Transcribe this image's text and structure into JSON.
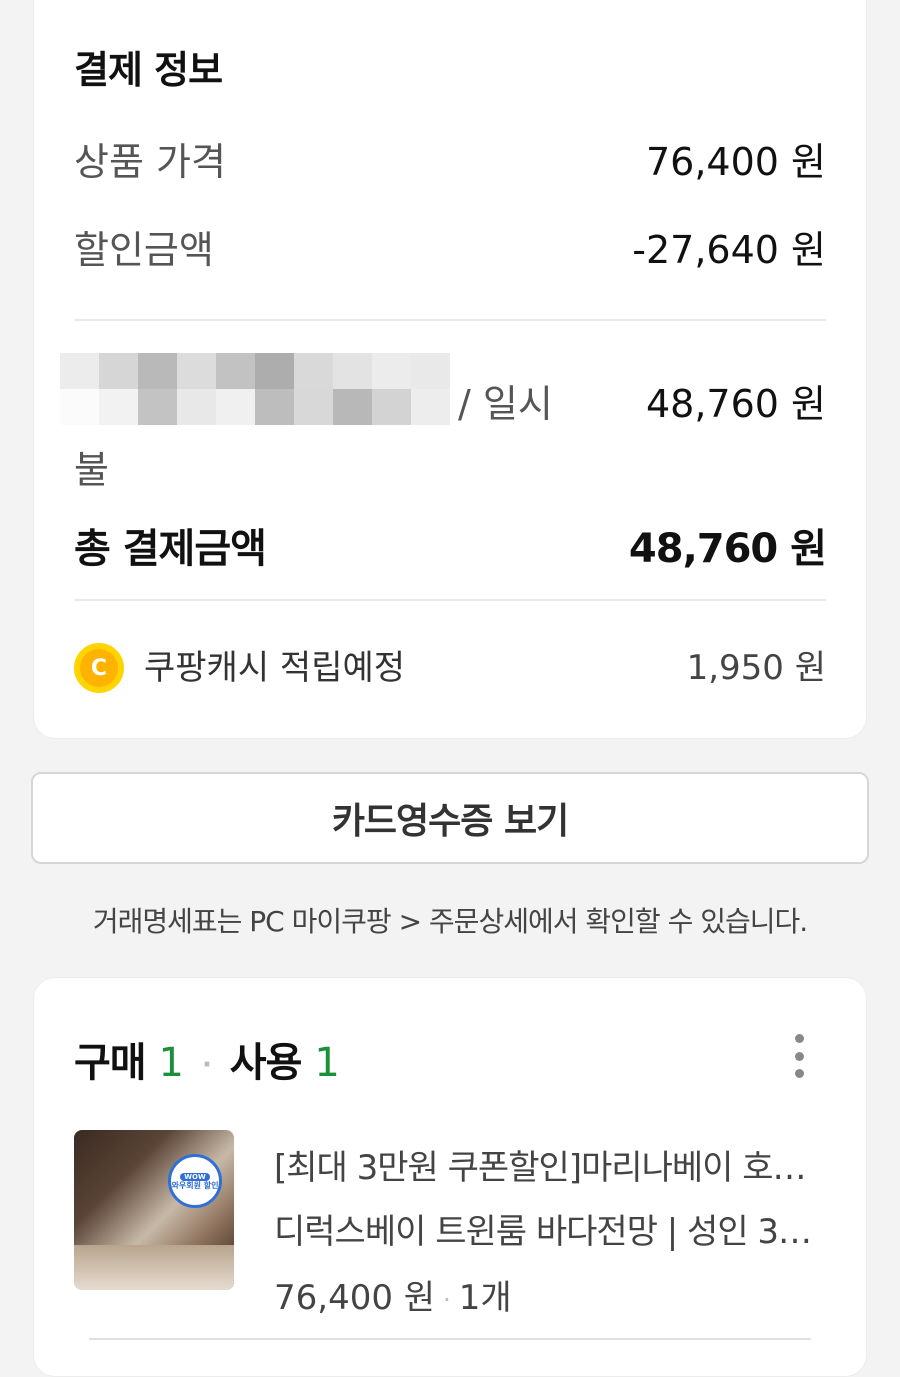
{
  "payment": {
    "title": "결제 정보",
    "product_price_label": "상품 가격",
    "product_price_value": "76,400 원",
    "discount_label": "할인금액",
    "discount_value": "-27,640 원",
    "method_suffix": "/ 일시",
    "method_wrap": "불",
    "method_value": "48,760 원",
    "total_label": "총 결제금액",
    "total_value": "48,760 원",
    "coin_letter": "C",
    "cash_label": "쿠팡캐시 적립예정",
    "cash_value": "1,950 원",
    "coin_color": "#ffd400"
  },
  "receipt_button": "카드영수증 보기",
  "notice": "거래명세표는 PC 마이쿠팡 > 주문상세에서 확인할 수 있습니다.",
  "order": {
    "purchase_label": "구매",
    "purchase_count": "1",
    "use_label": "사용",
    "use_count": "1",
    "accent_color": "#1b8f3a",
    "badge_wow": "WOW",
    "badge_text": "와우회원 할인",
    "product_line1": "[최대 3만원 쿠폰할인]마리나베이 호…",
    "product_line2": "디럭스베이 트윈룸 바다전망 | 성인 3…",
    "price": "76,400 원",
    "quantity": "1개"
  }
}
